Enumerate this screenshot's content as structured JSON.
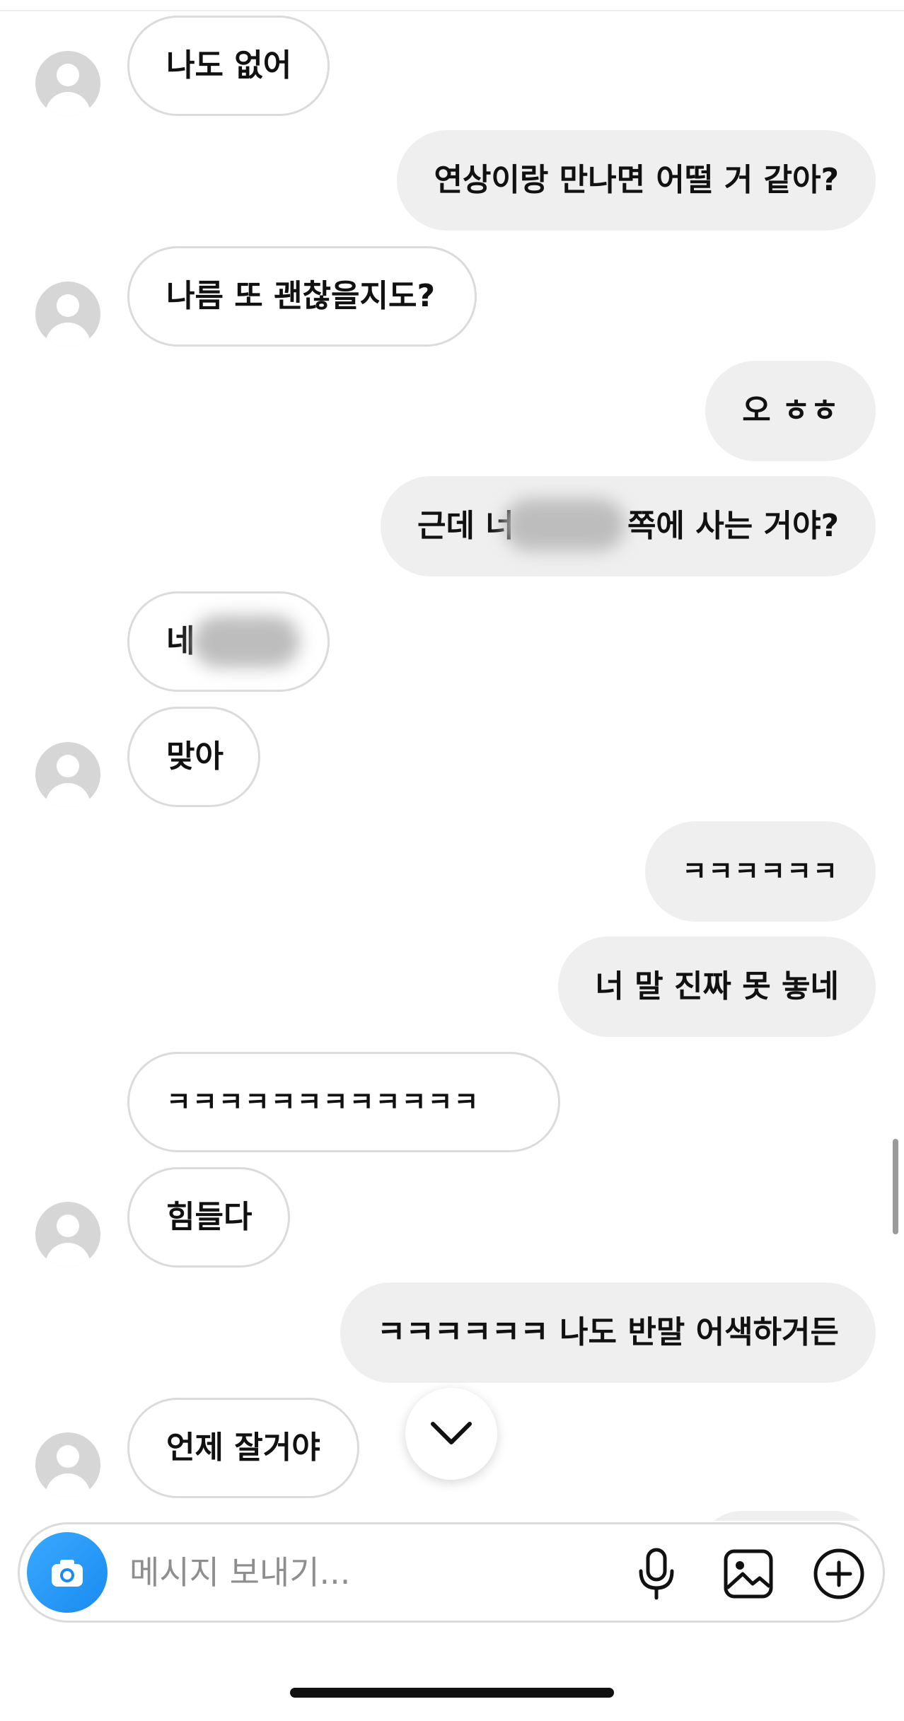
{
  "thread": {
    "m1": "나도 없어",
    "m2": "연상이랑 만나면 어떨 거 같아?",
    "m3": "나름 또 괜찮을지도?",
    "m4": "오 ㅎㅎ",
    "m5_prefix": "근데 너",
    "m5_suffix": "쪽에 사는 거야?",
    "m6": "네",
    "m7": "맞아",
    "m8": "ㅋㅋㅋㅋㅋㅋ",
    "m9": "너 말 진짜 못 놓네",
    "m10": "ㅋㅋㅋㅋㅋㅋㅋㅋㅋㅋㅋㅋ",
    "m11": "힘들다",
    "m12": "ㅋㅋㅋㅋㅋㅋ 나도 반말 어색하거든",
    "m13": "언제 잘거야"
  },
  "composer": {
    "placeholder": "메시지 보내기...",
    "icons": [
      "camera-icon",
      "microphone-icon",
      "gallery-icon",
      "plus-circle-icon"
    ]
  },
  "jump_icon": "chevron-down-icon",
  "colors": {
    "outgoing_bubble": "#efefef",
    "incoming_border": "#dbdbdb",
    "camera_button": "#1a8cf0",
    "avatar_placeholder": "#d6d6d6"
  }
}
